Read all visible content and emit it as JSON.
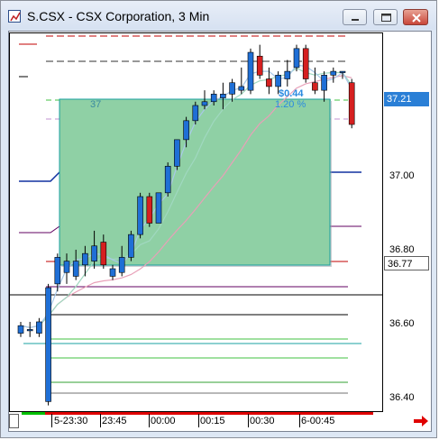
{
  "window": {
    "title": "S.CSX - CSX Corporation, 3 Min",
    "symbol": "S.CSX",
    "company": "CSX Corporation",
    "interval": "3 Min"
  },
  "chart_data": {
    "type": "candlestick",
    "symbol": "S.CSX",
    "interval": "3 Min",
    "price_axis": {
      "labels": [
        "37.00",
        "36.80",
        "36.60",
        "36.40"
      ],
      "range": [
        36.38,
        37.38
      ]
    },
    "time_axis": {
      "labels": [
        "5-23:30",
        "23:45",
        "00:00",
        "00:15",
        "00:30",
        "6-00:45"
      ]
    },
    "last_price": "37.21",
    "crosshair_price": "36.77",
    "trade_overlay": {
      "quantity": "37",
      "profit": "$0.44",
      "percent": "1.20 %"
    },
    "candles": [
      {
        "o": 36.59,
        "h": 36.62,
        "l": 36.58,
        "c": 36.61
      },
      {
        "o": 36.6,
        "h": 36.62,
        "l": 36.58,
        "c": 36.6
      },
      {
        "o": 36.59,
        "h": 36.63,
        "l": 36.58,
        "c": 36.62
      },
      {
        "o": 36.41,
        "h": 36.72,
        "l": 36.4,
        "c": 36.71
      },
      {
        "o": 36.72,
        "h": 36.8,
        "l": 36.7,
        "c": 36.79
      },
      {
        "o": 36.75,
        "h": 36.8,
        "l": 36.72,
        "c": 36.78
      },
      {
        "o": 36.74,
        "h": 36.81,
        "l": 36.73,
        "c": 36.78
      },
      {
        "o": 36.77,
        "h": 36.82,
        "l": 36.74,
        "c": 36.8
      },
      {
        "o": 36.78,
        "h": 36.86,
        "l": 36.76,
        "c": 36.82
      },
      {
        "o": 36.83,
        "h": 36.85,
        "l": 36.76,
        "c": 36.77
      },
      {
        "o": 36.74,
        "h": 36.77,
        "l": 36.73,
        "c": 36.76
      },
      {
        "o": 36.75,
        "h": 36.82,
        "l": 36.74,
        "c": 36.79
      },
      {
        "o": 36.79,
        "h": 36.86,
        "l": 36.78,
        "c": 36.85
      },
      {
        "o": 36.85,
        "h": 36.96,
        "l": 36.84,
        "c": 36.95
      },
      {
        "o": 36.95,
        "h": 36.96,
        "l": 36.87,
        "c": 36.88
      },
      {
        "o": 36.88,
        "h": 36.96,
        "l": 36.88,
        "c": 36.96
      },
      {
        "o": 36.96,
        "h": 37.04,
        "l": 36.95,
        "c": 37.03
      },
      {
        "o": 37.03,
        "h": 37.1,
        "l": 37.02,
        "c": 37.1
      },
      {
        "o": 37.1,
        "h": 37.16,
        "l": 37.08,
        "c": 37.15
      },
      {
        "o": 37.15,
        "h": 37.2,
        "l": 37.14,
        "c": 37.19
      },
      {
        "o": 37.19,
        "h": 37.23,
        "l": 37.18,
        "c": 37.2
      },
      {
        "o": 37.2,
        "h": 37.23,
        "l": 37.19,
        "c": 37.22
      },
      {
        "o": 37.21,
        "h": 37.25,
        "l": 37.18,
        "c": 37.22
      },
      {
        "o": 37.22,
        "h": 37.26,
        "l": 37.2,
        "c": 37.25
      },
      {
        "o": 37.23,
        "h": 37.29,
        "l": 37.22,
        "c": 37.24
      },
      {
        "o": 37.23,
        "h": 37.34,
        "l": 37.22,
        "c": 37.33
      },
      {
        "o": 37.32,
        "h": 37.35,
        "l": 37.26,
        "c": 37.27
      },
      {
        "o": 37.26,
        "h": 37.29,
        "l": 37.22,
        "c": 37.24
      },
      {
        "o": 37.24,
        "h": 37.28,
        "l": 37.22,
        "c": 37.27
      },
      {
        "o": 37.26,
        "h": 37.31,
        "l": 37.24,
        "c": 37.28
      },
      {
        "o": 37.29,
        "h": 37.35,
        "l": 37.28,
        "c": 37.34
      },
      {
        "o": 37.34,
        "h": 37.35,
        "l": 37.25,
        "c": 37.26
      },
      {
        "o": 37.25,
        "h": 37.29,
        "l": 37.22,
        "c": 37.23
      },
      {
        "o": 37.23,
        "h": 37.28,
        "l": 37.2,
        "c": 37.27
      },
      {
        "o": 37.27,
        "h": 37.29,
        "l": 37.25,
        "c": 37.28
      },
      {
        "o": 37.28,
        "h": 37.28,
        "l": 37.26,
        "c": 37.28
      },
      {
        "o": 37.25,
        "h": 37.26,
        "l": 37.13,
        "c": 37.14
      }
    ],
    "colors": {
      "up": "#1f6fd6",
      "down": "#d62020",
      "trade_box": "#8fd0a5"
    }
  }
}
